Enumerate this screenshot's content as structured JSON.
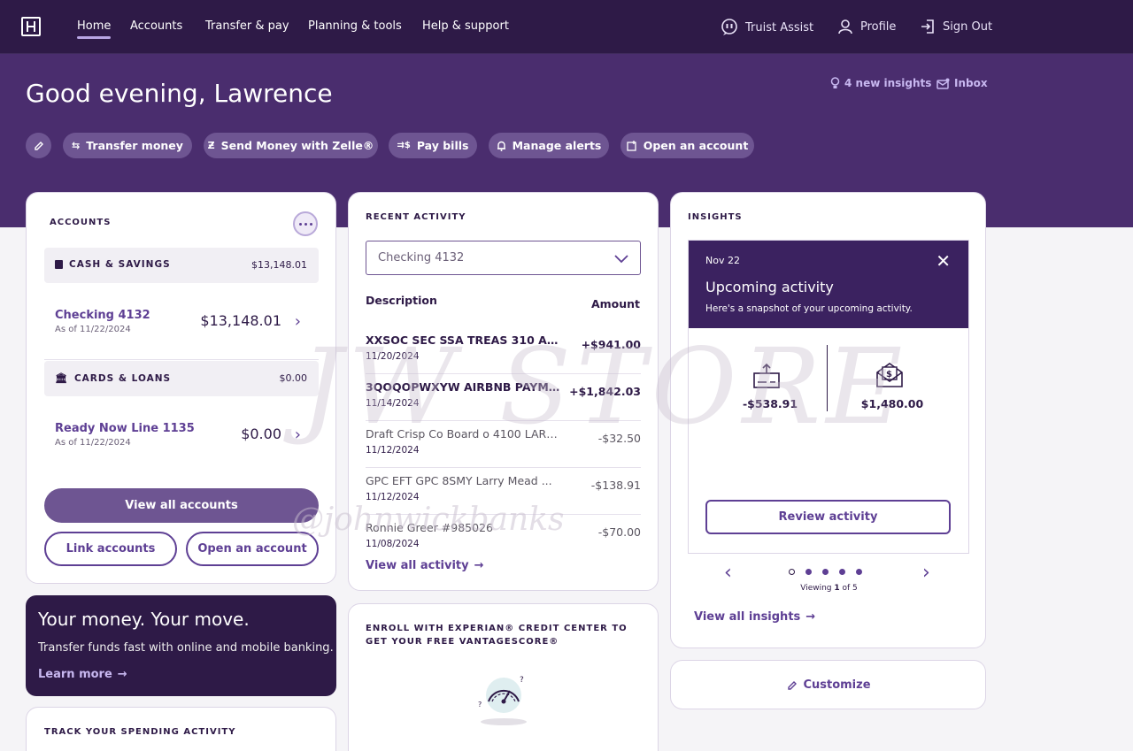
{
  "nav": {
    "items": [
      "Home",
      "Accounts",
      "Transfer & pay",
      "Planning & tools",
      "Help & support"
    ],
    "assist": "Truist Assist",
    "profile": "Profile",
    "signout": "Sign Out"
  },
  "hero": {
    "greeting": "Good evening, Lawrence",
    "insights_link": "4 new insights",
    "inbox_link": "Inbox",
    "actions": [
      "Transfer money",
      "Send Money with Zelle®",
      "Pay bills",
      "Manage alerts",
      "Open an account"
    ]
  },
  "accounts": {
    "title": "ACCOUNTS",
    "cash_label": "CASH & SAVINGS",
    "cash_total": "$13,148.01",
    "checking_name": "Checking 4132",
    "checking_asof": "As of 11/22/2024",
    "checking_balance": "$13,148.01",
    "cards_label": "CARDS & LOANS",
    "cards_total": "$0.00",
    "loan_name": "Ready Now Line 1135",
    "loan_asof": "As of 11/22/2024",
    "loan_balance": "$0.00",
    "view_all": "View all accounts",
    "link": "Link accounts",
    "open": "Open an account"
  },
  "promo": {
    "title": "Your money. Your move.",
    "body": "Transfer funds fast with online and mobile banking.",
    "link": "Learn more"
  },
  "spending": {
    "title": "TRACK YOUR SPENDING ACTIVITY"
  },
  "activity": {
    "title": "RECENT ACTIVITY",
    "selected_account": "Checking 4132",
    "col_desc": "Description",
    "col_amount": "Amount",
    "rows": [
      {
        "desc": "XXSOC SEC SSA TREAS 310 AS...",
        "date": "11/20/2024",
        "amount": "+$941.00"
      },
      {
        "desc": "3QOQOPWXYW AIRBNB PAYME...",
        "date": "11/14/2024",
        "amount": "+$1,842.03"
      },
      {
        "desc": "Draft Crisp Co Board o 4100 LARR...",
        "date": "11/12/2024",
        "amount": "-$32.50"
      },
      {
        "desc": "GPC EFT GPC 8SMY Larry Mead ...",
        "date": "11/12/2024",
        "amount": "-$138.91"
      },
      {
        "desc": "Ronnie Greer #985026",
        "date": "11/08/2024",
        "amount": "-$70.00"
      }
    ],
    "view_all": "View all activity"
  },
  "experian": {
    "title": "ENROLL WITH EXPERIAN® CREDIT CENTER TO GET YOUR FREE VANTAGESCORE®"
  },
  "insights": {
    "title": "INSIGHTS",
    "date": "Nov 22",
    "heading": "Upcoming activity",
    "sub": "Here's a snapshot of your upcoming activity.",
    "outgoing": "-$538.91",
    "incoming": "$1,480.00",
    "review": "Review activity",
    "viewing_prefix": "Viewing ",
    "viewing_current": "1",
    "viewing_suffix": " of 5",
    "view_all": "View all insights"
  },
  "customize": "Customize",
  "watermark": {
    "line1": "JW STORE",
    "line2": "@johnwickbanks"
  },
  "colors": {
    "nav_bg": "#2e1a47",
    "hero_bg": "#4a2d6e",
    "accent": "#5e3f94",
    "button": "#6e5592"
  },
  "icons": [
    "truist-logo-icon",
    "chat-assist-icon",
    "user-icon",
    "sign-out-icon",
    "lightbulb-icon",
    "inbox-icon",
    "pencil-icon",
    "transfer-icon",
    "zelle-icon",
    "pay-bills-icon",
    "bell-icon",
    "open-account-icon",
    "more-dots-icon",
    "wallet-icon",
    "bank-icon",
    "chevron-right-icon",
    "chevron-down-icon",
    "arrow-right-icon",
    "close-icon",
    "outgoing-check-icon",
    "incoming-envelope-icon",
    "credit-gauge-icon"
  ]
}
